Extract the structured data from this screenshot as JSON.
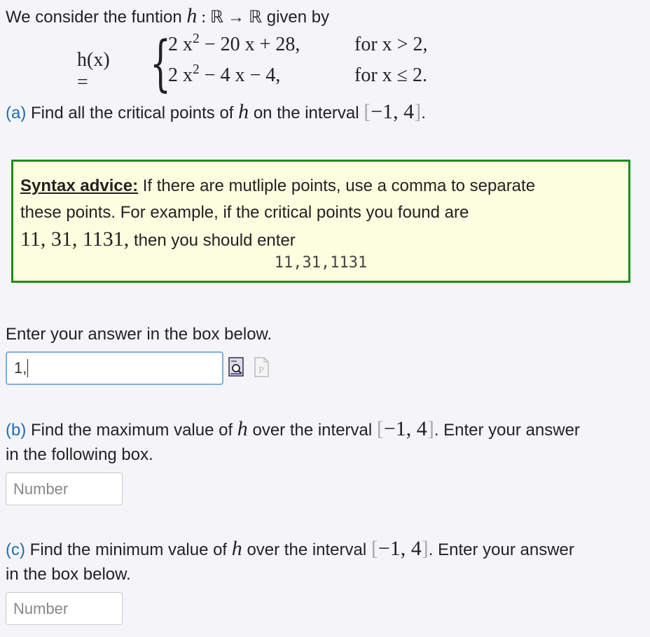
{
  "intro": {
    "before": "We consider the funtion ",
    "func": "h",
    "mapping": " : ℝ → ℝ",
    "after": " given by"
  },
  "piecewise": {
    "lhs": "h(x) =",
    "case1_expr_a": "2 x",
    "case1_expr_b": " − 20 x + 28,",
    "case1_cond": "for x > 2,",
    "case2_expr_a": "2 x",
    "case2_expr_b": " − 4 x − 4,",
    "case2_cond": "for x ≤ 2.",
    "exponent": "2"
  },
  "partA": {
    "label": "(a)",
    "text_before": " Find all the critical points of ",
    "func": "h",
    "text_after": " on the interval ",
    "interval_open": "[",
    "interval_body": "−1, 4",
    "interval_close": "]",
    "period": "."
  },
  "hint": {
    "title": "Syntax advice:",
    "line1": " If there are mutliple points, use a comma to separate",
    "line2": "these points. For example, if the critical points you found are",
    "example_math": "11, 31, 1131,",
    "line3": " then you should enter",
    "code": "11,31,1131"
  },
  "enter_prompt": "Enter your answer in the box below.",
  "answerA": {
    "value": "1,"
  },
  "partB": {
    "label": "(b)",
    "text_before": " Find the maximum value of ",
    "func": "h",
    "text_after": " over the interval ",
    "interval_open": "[",
    "interval_body": "−1, 4",
    "interval_close": "]",
    "text_end": ". Enter your answer",
    "line2": "in the following box.",
    "placeholder": "Number"
  },
  "partC": {
    "label": "(c)",
    "text_before": " Find the minimum value of ",
    "func": "h",
    "text_after": " over the interval ",
    "interval_open": "[",
    "interval_body": "−1, 4",
    "interval_close": "]",
    "text_end": ". Enter your answer",
    "line2": "in the box below.",
    "placeholder": "Number"
  },
  "icons": [
    "preview-icon",
    "pdf-icon"
  ]
}
